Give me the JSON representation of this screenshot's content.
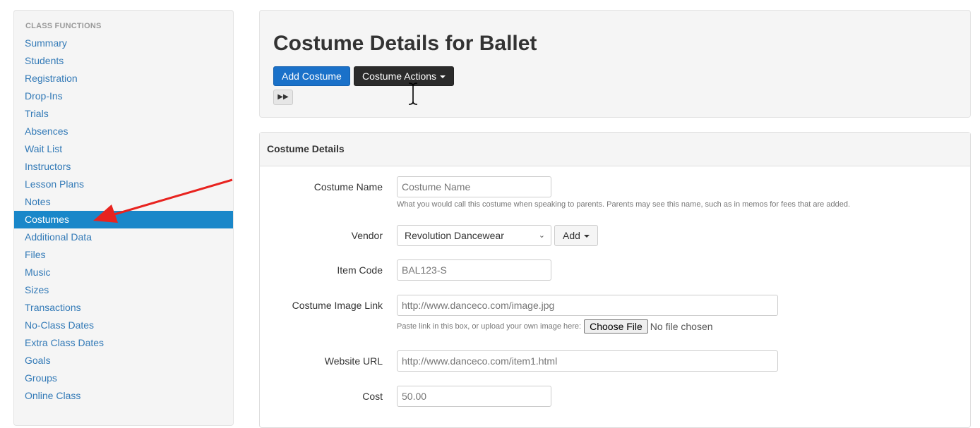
{
  "sidebar": {
    "header": "CLASS FUNCTIONS",
    "items": [
      {
        "label": "Summary"
      },
      {
        "label": "Students"
      },
      {
        "label": "Registration"
      },
      {
        "label": "Drop-Ins"
      },
      {
        "label": "Trials"
      },
      {
        "label": "Absences"
      },
      {
        "label": "Wait List"
      },
      {
        "label": "Instructors"
      },
      {
        "label": "Lesson Plans"
      },
      {
        "label": "Notes"
      },
      {
        "label": "Costumes",
        "active": true
      },
      {
        "label": "Additional Data"
      },
      {
        "label": "Files"
      },
      {
        "label": "Music"
      },
      {
        "label": "Sizes"
      },
      {
        "label": "Transactions"
      },
      {
        "label": "No-Class Dates"
      },
      {
        "label": "Extra Class Dates"
      },
      {
        "label": "Goals"
      },
      {
        "label": "Groups"
      },
      {
        "label": "Online Class"
      }
    ]
  },
  "header": {
    "title": "Costume Details for Ballet",
    "add_costume_label": "Add Costume",
    "costume_actions_label": "Costume Actions",
    "forward_icon": "fast-forward-icon"
  },
  "details": {
    "heading": "Costume Details",
    "costume_name": {
      "label": "Costume Name",
      "placeholder": "Costume Name",
      "help": "What you would call this costume when speaking to parents. Parents may see this name, such as in memos for fees that are added."
    },
    "vendor": {
      "label": "Vendor",
      "selected": "Revolution Dancewear",
      "add_label": "Add"
    },
    "item_code": {
      "label": "Item Code",
      "placeholder": "BAL123-S"
    },
    "image_link": {
      "label": "Costume Image Link",
      "placeholder": "http://www.danceco.com/image.jpg",
      "help": "Paste link in this box, or upload your own image here:",
      "choose_file_label": "Choose File",
      "file_status": "No file chosen"
    },
    "website_url": {
      "label": "Website URL",
      "placeholder": "http://www.danceco.com/item1.html"
    },
    "cost": {
      "label": "Cost",
      "placeholder": "50.00"
    }
  },
  "colors": {
    "link": "#337ab7",
    "active_nav": "#1a87c9",
    "primary_button": "#1a71c9",
    "dark_button": "#2b2b2b",
    "annotation_arrow": "#e8231f"
  }
}
